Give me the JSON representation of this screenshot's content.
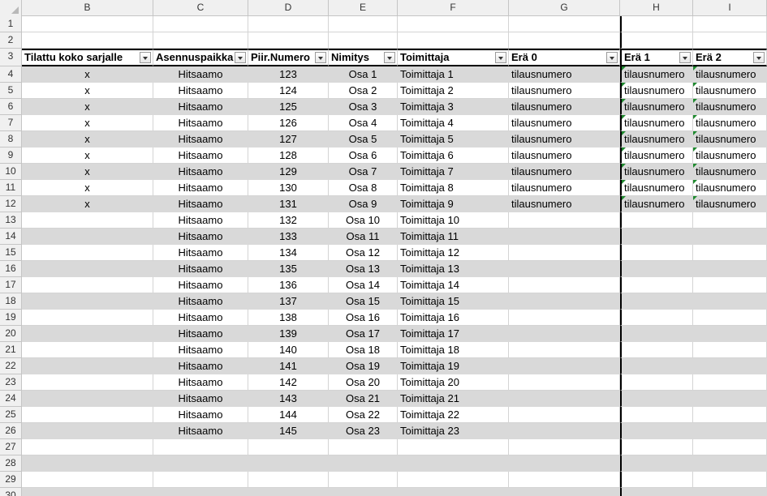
{
  "columns": [
    "B",
    "C",
    "D",
    "E",
    "F",
    "G",
    "H",
    "I"
  ],
  "headers": [
    "Tilattu koko sarjalle",
    "Asennuspaikka",
    "Piir.Numero",
    "Nimitys",
    "Toimittaja",
    "Erä 0",
    "Erä 1",
    "Erä 2"
  ],
  "rows": [
    {
      "n": "1",
      "cells": [
        "",
        "",
        "",
        "",
        "",
        "",
        "",
        ""
      ]
    },
    {
      "n": "2",
      "cells": [
        "",
        "",
        "",
        "",
        "",
        "",
        "",
        ""
      ]
    },
    {
      "n": "4",
      "cells": [
        "x",
        "Hitsaamo",
        "123",
        "Osa 1",
        "Toimittaja 1",
        "tilausnumero",
        "tilausnumero",
        "tilausnumero"
      ]
    },
    {
      "n": "5",
      "cells": [
        "x",
        "Hitsaamo",
        "124",
        "Osa 2",
        "Toimittaja 2",
        "tilausnumero",
        "tilausnumero",
        "tilausnumero"
      ]
    },
    {
      "n": "6",
      "cells": [
        "x",
        "Hitsaamo",
        "125",
        "Osa 3",
        "Toimittaja 3",
        "tilausnumero",
        "tilausnumero",
        "tilausnumero"
      ]
    },
    {
      "n": "7",
      "cells": [
        "x",
        "Hitsaamo",
        "126",
        "Osa 4",
        "Toimittaja 4",
        "tilausnumero",
        "tilausnumero",
        "tilausnumero"
      ]
    },
    {
      "n": "8",
      "cells": [
        "x",
        "Hitsaamo",
        "127",
        "Osa 5",
        "Toimittaja 5",
        "tilausnumero",
        "tilausnumero",
        "tilausnumero"
      ]
    },
    {
      "n": "9",
      "cells": [
        "x",
        "Hitsaamo",
        "128",
        "Osa 6",
        "Toimittaja 6",
        "tilausnumero",
        "tilausnumero",
        "tilausnumero"
      ]
    },
    {
      "n": "10",
      "cells": [
        "x",
        "Hitsaamo",
        "129",
        "Osa 7",
        "Toimittaja 7",
        "tilausnumero",
        "tilausnumero",
        "tilausnumero"
      ]
    },
    {
      "n": "11",
      "cells": [
        "x",
        "Hitsaamo",
        "130",
        "Osa 8",
        "Toimittaja 8",
        "tilausnumero",
        "tilausnumero",
        "tilausnumero"
      ]
    },
    {
      "n": "12",
      "cells": [
        "x",
        "Hitsaamo",
        "131",
        "Osa 9",
        "Toimittaja 9",
        "tilausnumero",
        "tilausnumero",
        "tilausnumero"
      ]
    },
    {
      "n": "13",
      "cells": [
        "",
        "Hitsaamo",
        "132",
        "Osa 10",
        "Toimittaja 10",
        "",
        "",
        ""
      ]
    },
    {
      "n": "14",
      "cells": [
        "",
        "Hitsaamo",
        "133",
        "Osa 11",
        "Toimittaja 11",
        "",
        "",
        ""
      ]
    },
    {
      "n": "15",
      "cells": [
        "",
        "Hitsaamo",
        "134",
        "Osa 12",
        "Toimittaja 12",
        "",
        "",
        ""
      ]
    },
    {
      "n": "16",
      "cells": [
        "",
        "Hitsaamo",
        "135",
        "Osa 13",
        "Toimittaja 13",
        "",
        "",
        ""
      ]
    },
    {
      "n": "17",
      "cells": [
        "",
        "Hitsaamo",
        "136",
        "Osa 14",
        "Toimittaja 14",
        "",
        "",
        ""
      ]
    },
    {
      "n": "18",
      "cells": [
        "",
        "Hitsaamo",
        "137",
        "Osa 15",
        "Toimittaja 15",
        "",
        "",
        ""
      ]
    },
    {
      "n": "19",
      "cells": [
        "",
        "Hitsaamo",
        "138",
        "Osa 16",
        "Toimittaja 16",
        "",
        "",
        ""
      ]
    },
    {
      "n": "20",
      "cells": [
        "",
        "Hitsaamo",
        "139",
        "Osa 17",
        "Toimittaja 17",
        "",
        "",
        ""
      ]
    },
    {
      "n": "21",
      "cells": [
        "",
        "Hitsaamo",
        "140",
        "Osa 18",
        "Toimittaja 18",
        "",
        "",
        ""
      ]
    },
    {
      "n": "22",
      "cells": [
        "",
        "Hitsaamo",
        "141",
        "Osa 19",
        "Toimittaja 19",
        "",
        "",
        ""
      ]
    },
    {
      "n": "23",
      "cells": [
        "",
        "Hitsaamo",
        "142",
        "Osa 20",
        "Toimittaja 20",
        "",
        "",
        ""
      ]
    },
    {
      "n": "24",
      "cells": [
        "",
        "Hitsaamo",
        "143",
        "Osa 21",
        "Toimittaja 21",
        "",
        "",
        ""
      ]
    },
    {
      "n": "25",
      "cells": [
        "",
        "Hitsaamo",
        "144",
        "Osa 22",
        "Toimittaja 22",
        "",
        "",
        ""
      ]
    },
    {
      "n": "26",
      "cells": [
        "",
        "Hitsaamo",
        "145",
        "Osa 23",
        "Toimittaja 23",
        "",
        "",
        ""
      ]
    },
    {
      "n": "27",
      "cells": [
        "",
        "",
        "",
        "",
        "",
        "",
        "",
        ""
      ]
    },
    {
      "n": "28",
      "cells": [
        "",
        "",
        "",
        "",
        "",
        "",
        "",
        ""
      ]
    },
    {
      "n": "29",
      "cells": [
        "",
        "",
        "",
        "",
        "",
        "",
        "",
        ""
      ]
    },
    {
      "n": "30",
      "cells": [
        "",
        "",
        "",
        "",
        "",
        "",
        "",
        ""
      ]
    }
  ],
  "header_row_number": "3",
  "colors": {
    "band": "#d9d9d9",
    "error_marker": "#1e8a2e"
  }
}
